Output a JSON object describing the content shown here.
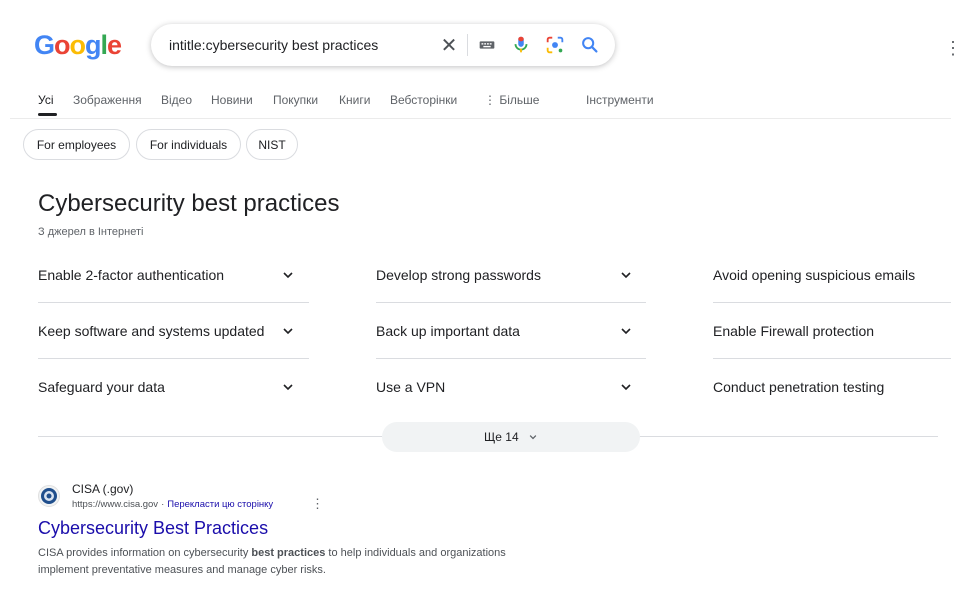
{
  "logo": {
    "letters": [
      "G",
      "o",
      "o",
      "g",
      "l",
      "e"
    ],
    "colors": [
      "#4285F4",
      "#EA4335",
      "#FBBC05",
      "#4285F4",
      "#34A853",
      "#EA4335"
    ]
  },
  "search": {
    "query": "intitle:cybersecurity best practices",
    "clear_icon": "close-icon",
    "keyboard_icon": "keyboard-icon",
    "mic_icon": "mic-icon",
    "lens_icon": "lens-icon",
    "search_icon": "search-icon"
  },
  "tabs": [
    {
      "label": "Усі",
      "active": true
    },
    {
      "label": "Зображення"
    },
    {
      "label": "Відео"
    },
    {
      "label": "Новини"
    },
    {
      "label": "Покупки"
    },
    {
      "label": "Книги"
    },
    {
      "label": "Вебсторінки"
    },
    {
      "label": "⋮ Більше"
    },
    {
      "label": "Інструменти"
    }
  ],
  "chips": [
    "For employees",
    "For individuals",
    "NIST"
  ],
  "section": {
    "title": "Cybersecurity best practices",
    "subtitle": "З джерел в Інтернеті",
    "items": [
      [
        "Enable 2-factor authentication",
        "Develop strong passwords",
        "Avoid opening suspicious emails"
      ],
      [
        "Keep software and systems updated",
        "Back up important data",
        "Enable Firewall protection"
      ],
      [
        "Safeguard your data",
        "Use a VPN",
        "Conduct penetration testing"
      ]
    ],
    "more_label": "Ще 14"
  },
  "result": {
    "site_name": "CISA (.gov)",
    "url": "https://www.cisa.gov",
    "separator": "·",
    "translate": "Перекласти цю сторінку",
    "title": "Cybersecurity Best Practices",
    "snippet_pre": "CISA provides information on cybersecurity ",
    "snippet_bold": "best practices",
    "snippet_post": " to help individuals and organizations implement preventative measures and manage cyber risks."
  }
}
